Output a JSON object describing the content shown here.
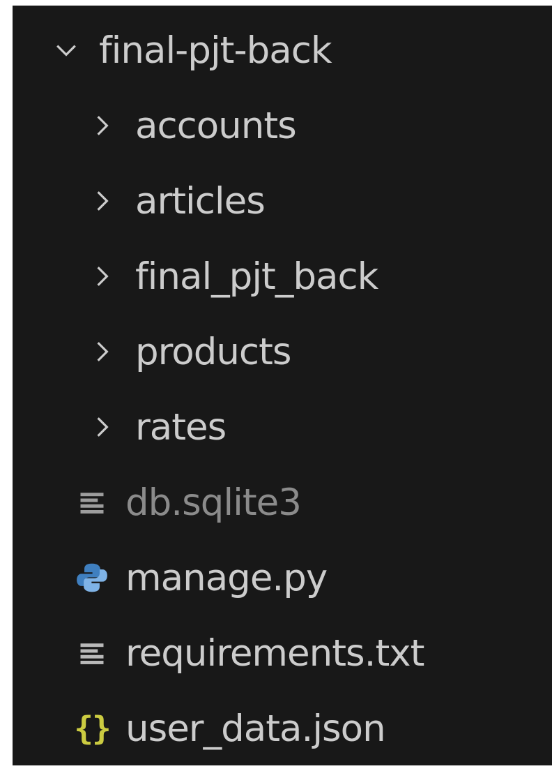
{
  "explorer": {
    "root": {
      "label": "final-pjt-back",
      "state": "expanded",
      "icon": "chevron-down-icon"
    },
    "folders": [
      {
        "label": "accounts",
        "state": "collapsed",
        "icon": "chevron-right-icon"
      },
      {
        "label": "articles",
        "state": "collapsed",
        "icon": "chevron-right-icon"
      },
      {
        "label": "final_pjt_back",
        "state": "collapsed",
        "icon": "chevron-right-icon"
      },
      {
        "label": "products",
        "state": "collapsed",
        "icon": "chevron-right-icon"
      },
      {
        "label": "rates",
        "state": "collapsed",
        "icon": "chevron-right-icon"
      }
    ],
    "files": [
      {
        "label": "db.sqlite3",
        "icon": "lines-file-icon",
        "dimmed": true
      },
      {
        "label": "manage.py",
        "icon": "python-file-icon",
        "dimmed": false
      },
      {
        "label": "requirements.txt",
        "icon": "lines-file-icon",
        "dimmed": false
      },
      {
        "label": "user_data.json",
        "icon": "json-braces-icon",
        "dimmed": false
      }
    ]
  },
  "colors": {
    "background": "#181818",
    "text": "#cccccc",
    "dimmed_text": "#8b8b8b",
    "json_icon": "#cbcb41",
    "python_blue": "#3f7fbf",
    "python_light": "#7fb3e6"
  }
}
